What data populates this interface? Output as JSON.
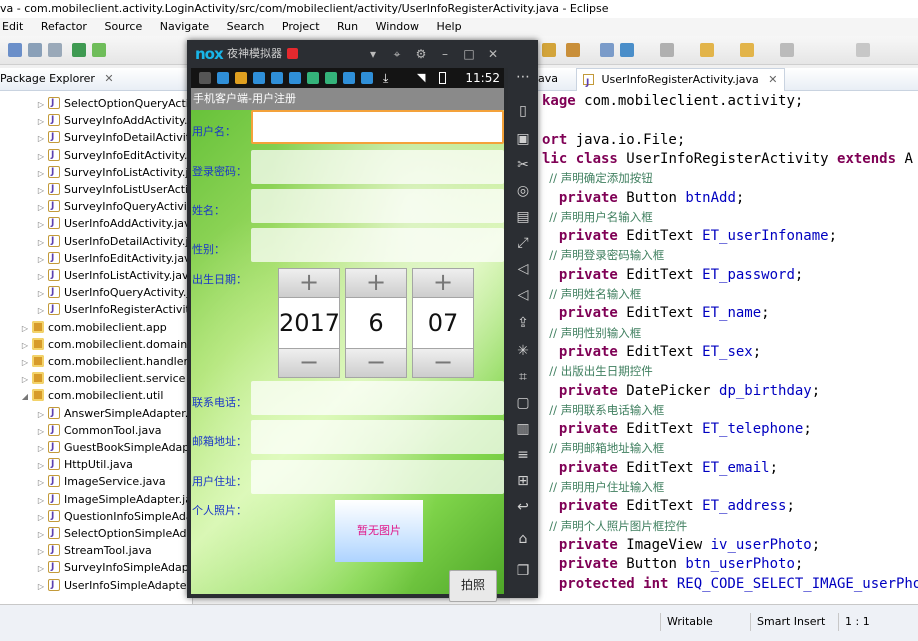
{
  "window": {
    "title": "va - com.mobileclient.activity.LoginActivity/src/com/mobileclient/activity/UserInfoRegisterActivity.java - Eclipse"
  },
  "menu": [
    "Edit",
    "Refactor",
    "Source",
    "Navigate",
    "Search",
    "Project",
    "Run",
    "Window",
    "Help"
  ],
  "package_explorer": {
    "tab_label": "Package Explorer",
    "items": [
      {
        "label": "SelectOptionQueryActiv",
        "type": "java"
      },
      {
        "label": "SurveyInfoAddActivity.ja",
        "type": "java"
      },
      {
        "label": "SurveyInfoDetailActivity.",
        "type": "java"
      },
      {
        "label": "SurveyInfoEditActivity.ja",
        "type": "java"
      },
      {
        "label": "SurveyInfoListActivity.jav",
        "type": "java"
      },
      {
        "label": "SurveyInfoListUserActiv",
        "type": "java"
      },
      {
        "label": "SurveyInfoQueryActivity",
        "type": "java"
      },
      {
        "label": "UserInfoAddActivity.java",
        "type": "java"
      },
      {
        "label": "UserInfoDetailActivity.ja",
        "type": "java"
      },
      {
        "label": "UserInfoEditActivity.java",
        "type": "java"
      },
      {
        "label": "UserInfoListActivity.java",
        "type": "java"
      },
      {
        "label": "UserInfoQueryActivity.ja",
        "type": "java"
      },
      {
        "label": "UserInfoRegisterActivity",
        "type": "java"
      },
      {
        "label": "com.mobileclient.app",
        "type": "pkg"
      },
      {
        "label": "com.mobileclient.domain",
        "type": "pkg"
      },
      {
        "label": "com.mobileclient.handler",
        "type": "pkg"
      },
      {
        "label": "com.mobileclient.service",
        "type": "pkg"
      },
      {
        "label": "com.mobileclient.util",
        "type": "pkg"
      },
      {
        "label": "AnswerSimpleAdapter.j",
        "type": "java"
      },
      {
        "label": "CommonTool.java",
        "type": "java"
      },
      {
        "label": "GuestBookSimpleAdap",
        "type": "java"
      },
      {
        "label": "HttpUtil.java",
        "type": "java"
      },
      {
        "label": "ImageService.java",
        "type": "java"
      },
      {
        "label": "ImageSimpleAdapter.ja",
        "type": "java"
      },
      {
        "label": "QuestionInfoSimpleAda",
        "type": "java"
      },
      {
        "label": "SelectOptionSimpleAda",
        "type": "java"
      },
      {
        "label": "StreamTool.java",
        "type": "java"
      },
      {
        "label": "SurveyInfoSimpleAdapt",
        "type": "java"
      },
      {
        "label": "UserInfoSimpleAdapter",
        "type": "java"
      }
    ]
  },
  "editor": {
    "tabs": [
      {
        "label": "ava"
      },
      {
        "label": "UserInfoRegisterActivity.java"
      }
    ],
    "lines": [
      [
        {
          "t": "kw",
          "s": "kage "
        },
        {
          "t": "",
          "s": "com.mobileclient.activity;"
        }
      ],
      [],
      [
        {
          "t": "kw",
          "s": "ort "
        },
        {
          "t": "",
          "s": "java.io.File;"
        }
      ],
      [
        {
          "t": "kw",
          "s": "lic class "
        },
        {
          "t": "",
          "s": "UserInfoRegisterActivity "
        },
        {
          "t": "kw",
          "s": "extends "
        },
        {
          "t": "",
          "s": "A"
        }
      ],
      [
        {
          "t": "cmt",
          "s": "  // 声明确定添加按钮"
        }
      ],
      [
        {
          "t": "kw",
          "s": "  private "
        },
        {
          "t": "",
          "s": "Button "
        },
        {
          "t": "fld",
          "s": "btnAdd"
        },
        {
          "t": "",
          "s": ";"
        }
      ],
      [
        {
          "t": "cmt",
          "s": "  // 声明用户名输入框"
        }
      ],
      [
        {
          "t": "kw",
          "s": "  private "
        },
        {
          "t": "",
          "s": "EditText "
        },
        {
          "t": "fld",
          "s": "ET_userInfoname"
        },
        {
          "t": "",
          "s": ";"
        }
      ],
      [
        {
          "t": "cmt",
          "s": "  // 声明登录密码输入框"
        }
      ],
      [
        {
          "t": "kw",
          "s": "  private "
        },
        {
          "t": "",
          "s": "EditText "
        },
        {
          "t": "fld",
          "s": "ET_password"
        },
        {
          "t": "",
          "s": ";"
        }
      ],
      [
        {
          "t": "cmt",
          "s": "  // 声明姓名输入框"
        }
      ],
      [
        {
          "t": "kw",
          "s": "  private "
        },
        {
          "t": "",
          "s": "EditText "
        },
        {
          "t": "fld",
          "s": "ET_name"
        },
        {
          "t": "",
          "s": ";"
        }
      ],
      [
        {
          "t": "cmt",
          "s": "  // 声明性别输入框"
        }
      ],
      [
        {
          "t": "kw",
          "s": "  private "
        },
        {
          "t": "",
          "s": "EditText "
        },
        {
          "t": "fld",
          "s": "ET_sex"
        },
        {
          "t": "",
          "s": ";"
        }
      ],
      [
        {
          "t": "cmt",
          "s": "  // 出版出生日期控件"
        }
      ],
      [
        {
          "t": "kw",
          "s": "  private "
        },
        {
          "t": "",
          "s": "DatePicker "
        },
        {
          "t": "fld",
          "s": "dp_birthday"
        },
        {
          "t": "",
          "s": ";"
        }
      ],
      [
        {
          "t": "cmt",
          "s": "  // 声明联系电话输入框"
        }
      ],
      [
        {
          "t": "kw",
          "s": "  private "
        },
        {
          "t": "",
          "s": "EditText "
        },
        {
          "t": "fld",
          "s": "ET_telephone"
        },
        {
          "t": "",
          "s": ";"
        }
      ],
      [
        {
          "t": "cmt",
          "s": "  // 声明邮箱地址输入框"
        }
      ],
      [
        {
          "t": "kw",
          "s": "  private "
        },
        {
          "t": "",
          "s": "EditText "
        },
        {
          "t": "fld",
          "s": "ET_email"
        },
        {
          "t": "",
          "s": ";"
        }
      ],
      [
        {
          "t": "cmt",
          "s": "  // 声明用户住址输入框"
        }
      ],
      [
        {
          "t": "kw",
          "s": "  private "
        },
        {
          "t": "",
          "s": "EditText "
        },
        {
          "t": "fld",
          "s": "ET_address"
        },
        {
          "t": "",
          "s": ";"
        }
      ],
      [
        {
          "t": "cmt",
          "s": "  // 声明个人照片图片框控件"
        }
      ],
      [
        {
          "t": "kw",
          "s": "  private "
        },
        {
          "t": "",
          "s": "ImageView "
        },
        {
          "t": "fld",
          "s": "iv_userPhoto"
        },
        {
          "t": "",
          "s": ";"
        }
      ],
      [
        {
          "t": "kw",
          "s": "  private "
        },
        {
          "t": "",
          "s": "Button "
        },
        {
          "t": "fld",
          "s": "btn_userPhoto"
        },
        {
          "t": "",
          "s": ";"
        }
      ],
      [
        {
          "t": "kw",
          "s": "  protected int "
        },
        {
          "t": "fld",
          "s": "REQ_CODE_SELECT_IMAGE_userPho"
        }
      ]
    ]
  },
  "status": {
    "writable": "Writable",
    "insert_mode": "Smart Insert",
    "position": "1 : 1"
  },
  "emulator": {
    "logo": "nox",
    "name": "夜神模拟器",
    "status_time": "11:52",
    "app_title": "手机客户端-用户注册",
    "labels": {
      "username": "用户名：",
      "password": "登录密码：",
      "name": "姓名：",
      "sex": "性别：",
      "birthday": "出生日期：",
      "telephone": "联系电话：",
      "email": "邮箱地址：",
      "address": "用户住址：",
      "photo": "个人照片："
    },
    "date_picker": {
      "year": "2017",
      "month": "6",
      "day": "07",
      "plus": "+",
      "minus": "−"
    },
    "photo_placeholder": "暂无图片",
    "photo_button": "拍照"
  },
  "colors": {
    "keyword": "#7f0055",
    "field": "#0000c0",
    "comment": "#3f7f5f",
    "label": "#1b37c8",
    "focus": "#f4a23a"
  }
}
